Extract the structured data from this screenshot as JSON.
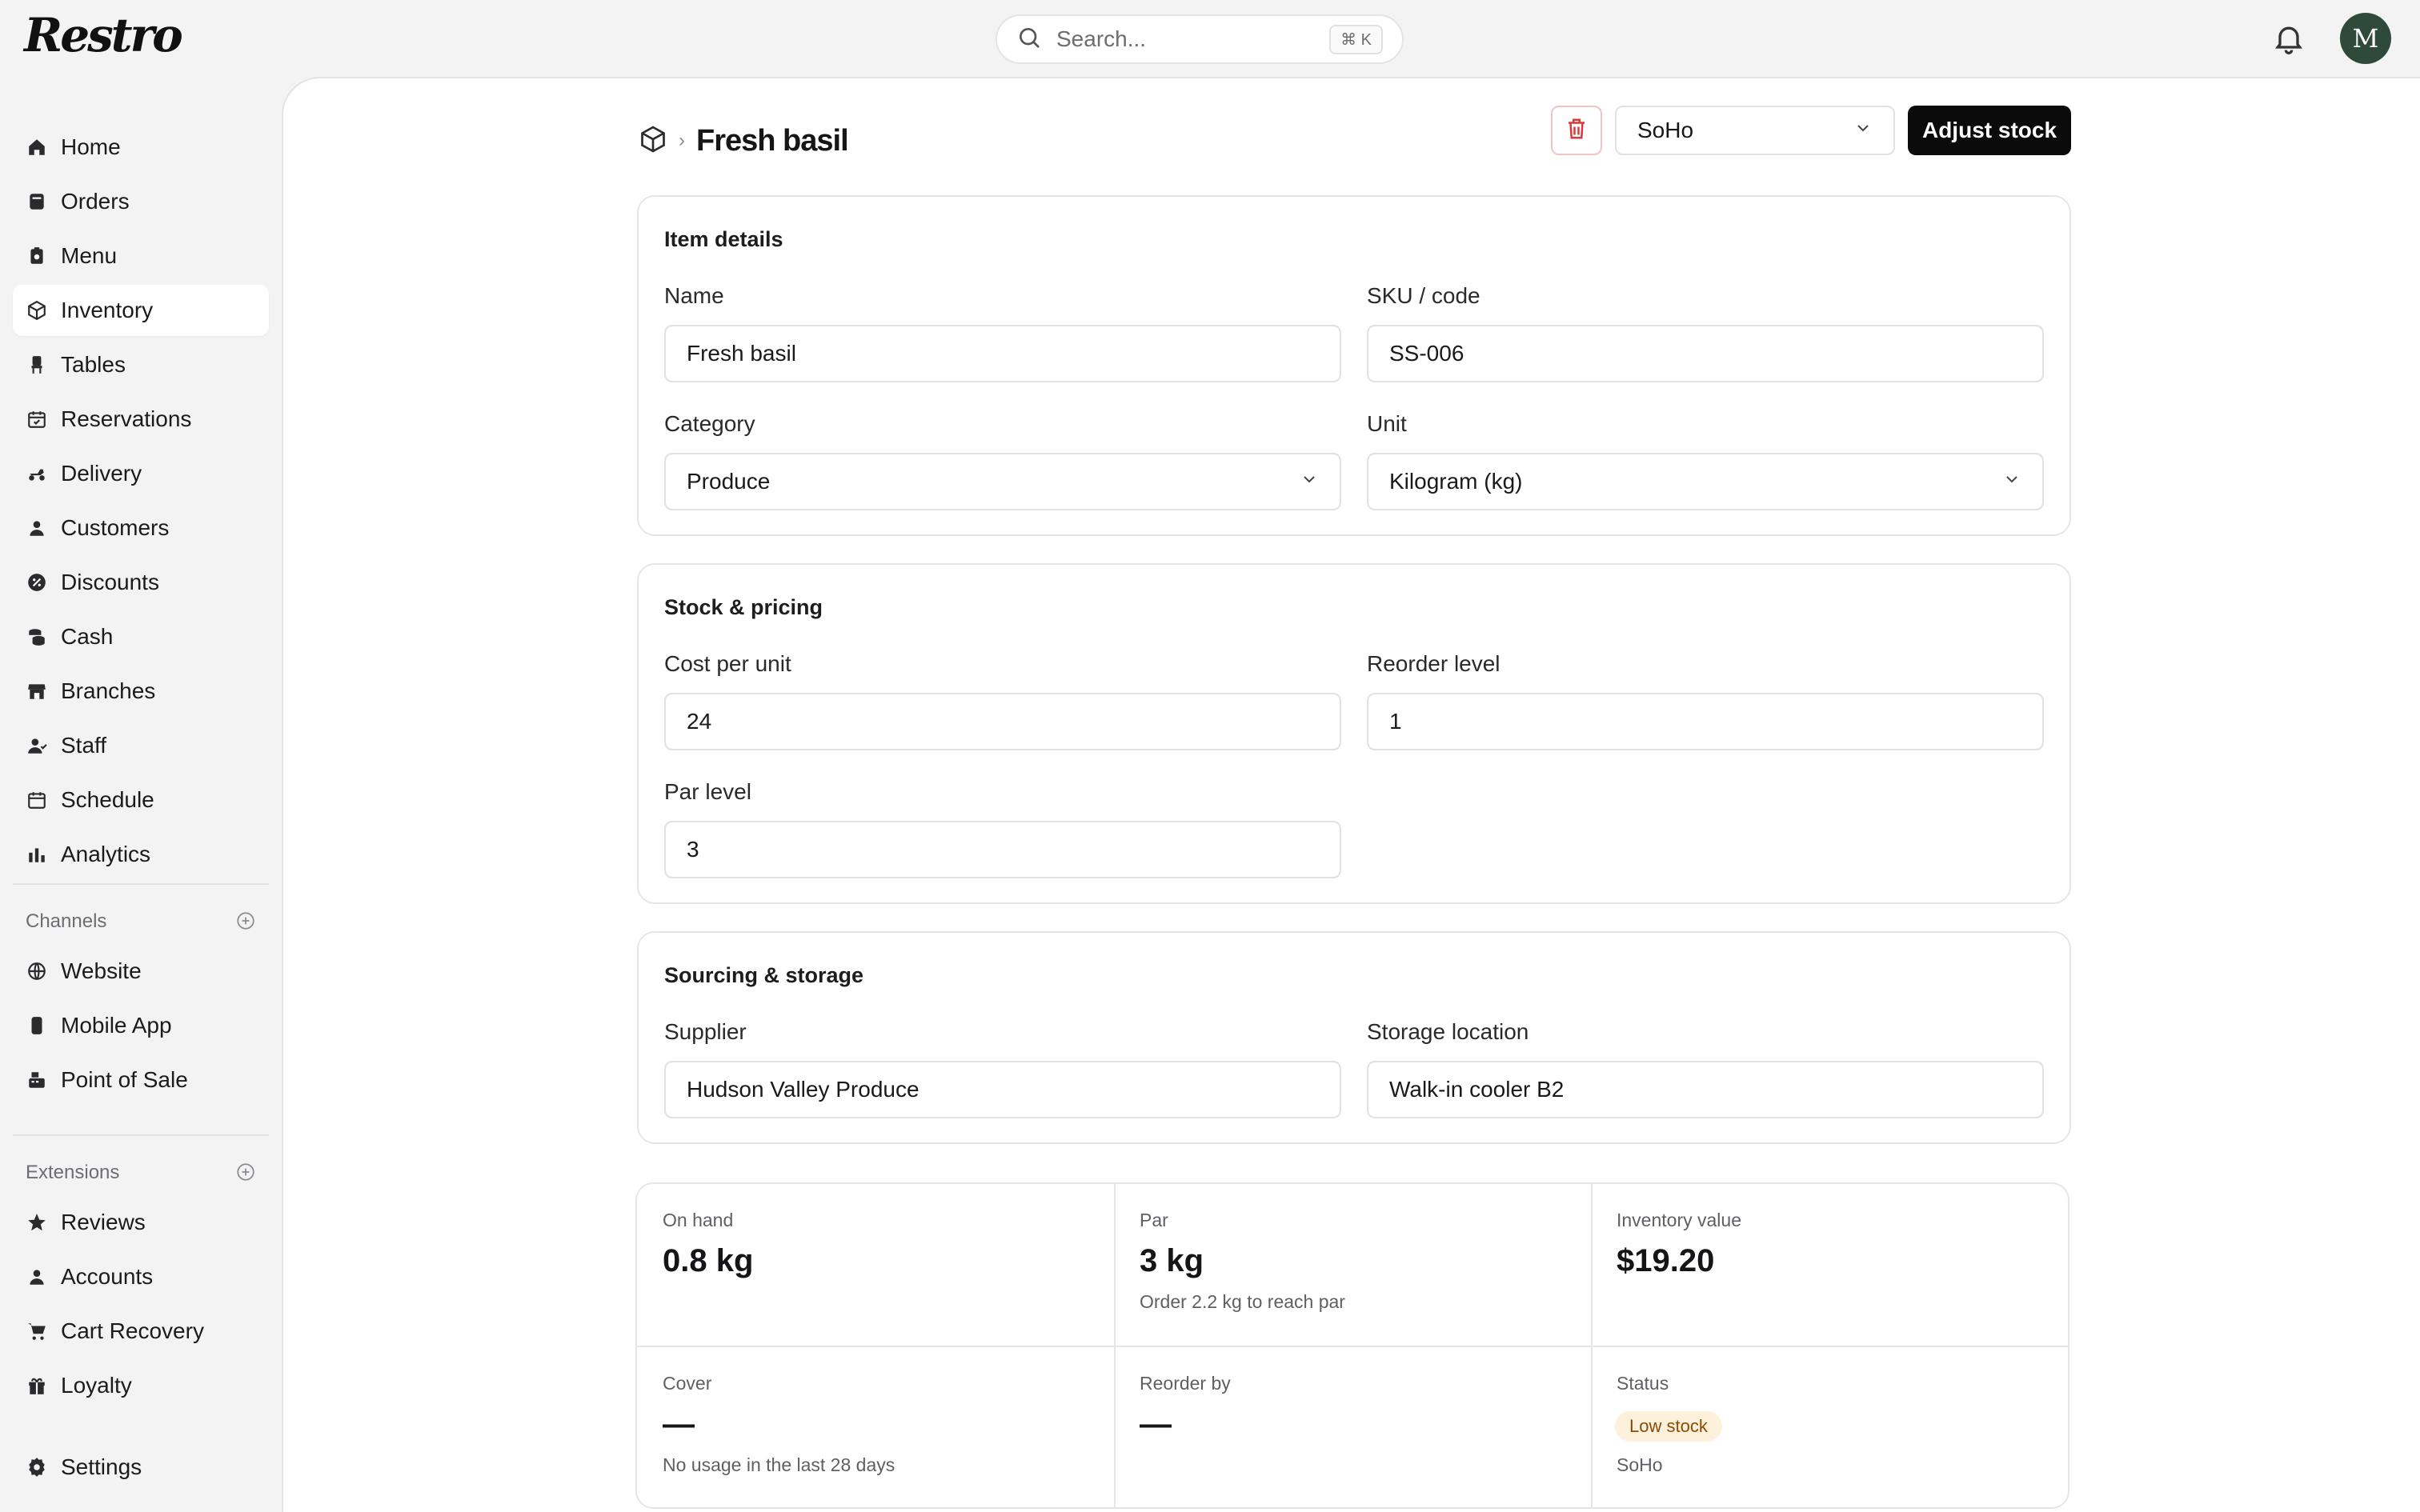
{
  "app": {
    "logo": "Restro"
  },
  "search": {
    "placeholder": "Search...",
    "shortcut": "⌘ K"
  },
  "user": {
    "avatar_initial": "M"
  },
  "sidebar": {
    "items": [
      {
        "label": "Home",
        "icon": "home-icon"
      },
      {
        "label": "Orders",
        "icon": "orders-icon"
      },
      {
        "label": "Menu",
        "icon": "menu-icon"
      },
      {
        "label": "Inventory",
        "icon": "box-icon",
        "active": true
      },
      {
        "label": "Tables",
        "icon": "chair-icon"
      },
      {
        "label": "Reservations",
        "icon": "calendar-check-icon"
      },
      {
        "label": "Delivery",
        "icon": "scooter-icon"
      },
      {
        "label": "Customers",
        "icon": "user-icon"
      },
      {
        "label": "Discounts",
        "icon": "discount-icon"
      },
      {
        "label": "Cash",
        "icon": "coins-icon"
      },
      {
        "label": "Branches",
        "icon": "store-icon"
      },
      {
        "label": "Staff",
        "icon": "staff-icon"
      },
      {
        "label": "Schedule",
        "icon": "calendar-icon"
      },
      {
        "label": "Analytics",
        "icon": "bar-chart-icon"
      }
    ],
    "channels_label": "Channels",
    "channels": [
      {
        "label": "Website",
        "icon": "globe-icon"
      },
      {
        "label": "Mobile App",
        "icon": "phone-icon"
      },
      {
        "label": "Point of Sale",
        "icon": "register-icon"
      }
    ],
    "extensions_label": "Extensions",
    "extensions": [
      {
        "label": "Reviews",
        "icon": "star-icon"
      },
      {
        "label": "Accounts",
        "icon": "user-icon"
      },
      {
        "label": "Cart Recovery",
        "icon": "cart-icon"
      },
      {
        "label": "Loyalty",
        "icon": "gift-icon"
      }
    ],
    "settings_label": "Settings"
  },
  "header": {
    "title": "Fresh basil",
    "branch": "SoHo",
    "adjust_label": "Adjust stock"
  },
  "item_details": {
    "title": "Item details",
    "name_label": "Name",
    "name_value": "Fresh basil",
    "sku_label": "SKU / code",
    "sku_value": "SS-006",
    "category_label": "Category",
    "category_value": "Produce",
    "unit_label": "Unit",
    "unit_value": "Kilogram (kg)"
  },
  "stock_pricing": {
    "title": "Stock & pricing",
    "cost_label": "Cost per unit",
    "cost_value": "24",
    "reorder_label": "Reorder level",
    "reorder_value": "1",
    "par_label": "Par level",
    "par_value": "3"
  },
  "sourcing": {
    "title": "Sourcing & storage",
    "supplier_label": "Supplier",
    "supplier_value": "Hudson Valley Produce",
    "storage_label": "Storage location",
    "storage_value": "Walk-in cooler B2"
  },
  "stats": {
    "on_hand_label": "On hand",
    "on_hand_value": "0.8 kg",
    "par_label": "Par",
    "par_value": "3 kg",
    "par_sub": "Order 2.2 kg to reach par",
    "inv_value_label": "Inventory value",
    "inv_value": "$19.20",
    "cover_label": "Cover",
    "cover_value": "—",
    "cover_sub": "No usage in the last 28 days",
    "reorder_by_label": "Reorder by",
    "reorder_by_value": "—",
    "status_label": "Status",
    "status_badge": "Low stock",
    "status_branch": "SoHo"
  },
  "colors": {
    "accent": "#0b0b0c",
    "danger": "#d63b3b",
    "warning_bg": "#fdf1dc",
    "warning_text": "#8a4b06"
  }
}
